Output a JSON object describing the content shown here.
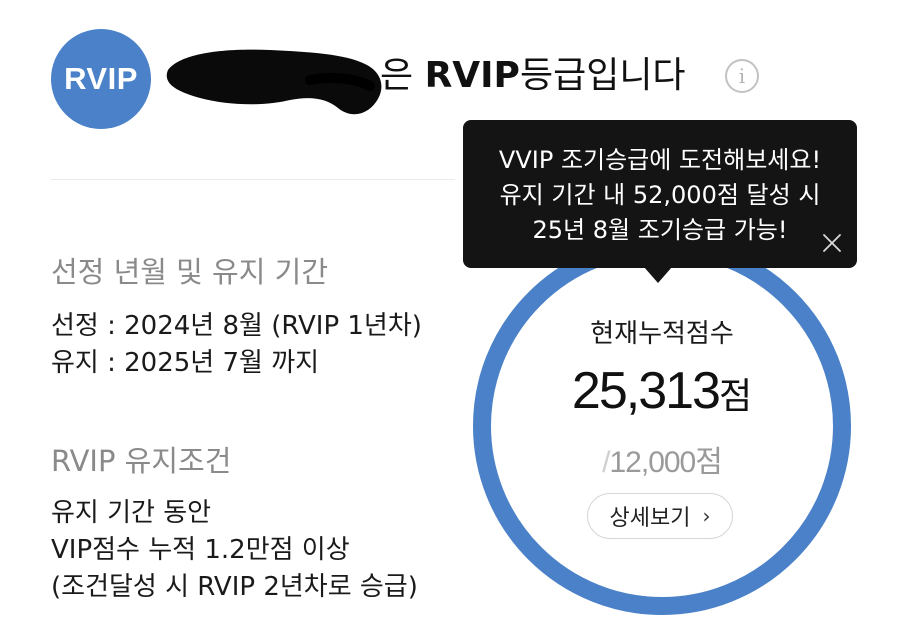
{
  "header": {
    "avatar_label": "RVIP",
    "name_suffix": "은 ",
    "grade": "RVIP",
    "grade_suffix": "등급입니다",
    "info_icon": "info-icon"
  },
  "selection_period": {
    "heading": "선정 년월 및 유지 기간",
    "selected_line": "선정 : 2024년 8월 (RVIP 1년차)",
    "maintain_line": "유지 : 2025년 7월 까지"
  },
  "maintain_condition": {
    "heading": "RVIP 유지조건",
    "lines": [
      "유지 기간 동안",
      "VIP점수 누적 1.2만점 이상",
      "(조건달성 시 RVIP 2년차로 승급)"
    ]
  },
  "score_gauge": {
    "title": "현재누적점수",
    "current_score": "25,313",
    "unit": "점",
    "target_slash": "/",
    "target_score": "12,000점",
    "detail_button_label": "상세보기",
    "chevron_icon": "chevron-right-icon",
    "ring_color": "#4a81c8",
    "fill_fraction": 1.0
  },
  "tooltip": {
    "lines": [
      "VVIP 조기승급에 도전해보세요!",
      "유지 기간 내 52,000점 달성 시",
      "25년 8월 조기승급 가능!"
    ],
    "close_icon": "close-icon",
    "background_color": "#141414"
  }
}
